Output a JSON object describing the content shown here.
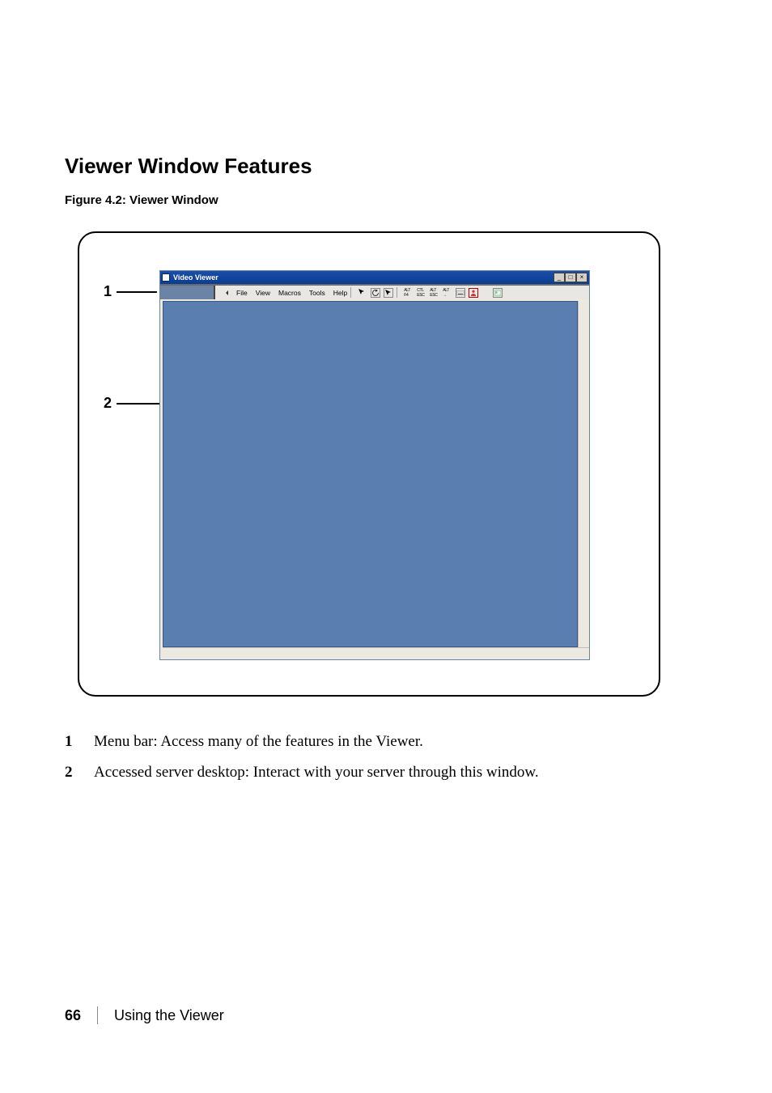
{
  "heading": "Viewer Window Features",
  "caption": "Figure 4.2: Viewer Window",
  "callouts": {
    "c1": "1",
    "c2": "2"
  },
  "window": {
    "title": "Video Viewer",
    "menu": {
      "file": "File",
      "view": "View",
      "macros": "Macros",
      "tools": "Tools",
      "help": "Help"
    },
    "toolbar_labels": {
      "altf4": "ALT\nF4",
      "ctrlesc": "CTL\nESC",
      "altesc": "ALT\nESC",
      "alttab": "ALT\n→"
    },
    "win_controls": {
      "min": "_",
      "max": "□",
      "close": "×"
    }
  },
  "legend": {
    "1": {
      "num": "1",
      "text": "Menu bar: Access many of the features in the Viewer."
    },
    "2": {
      "num": "2",
      "text": "Accessed server desktop: Interact with your server through this window."
    }
  },
  "footer": {
    "page": "66",
    "section": "Using the Viewer"
  }
}
